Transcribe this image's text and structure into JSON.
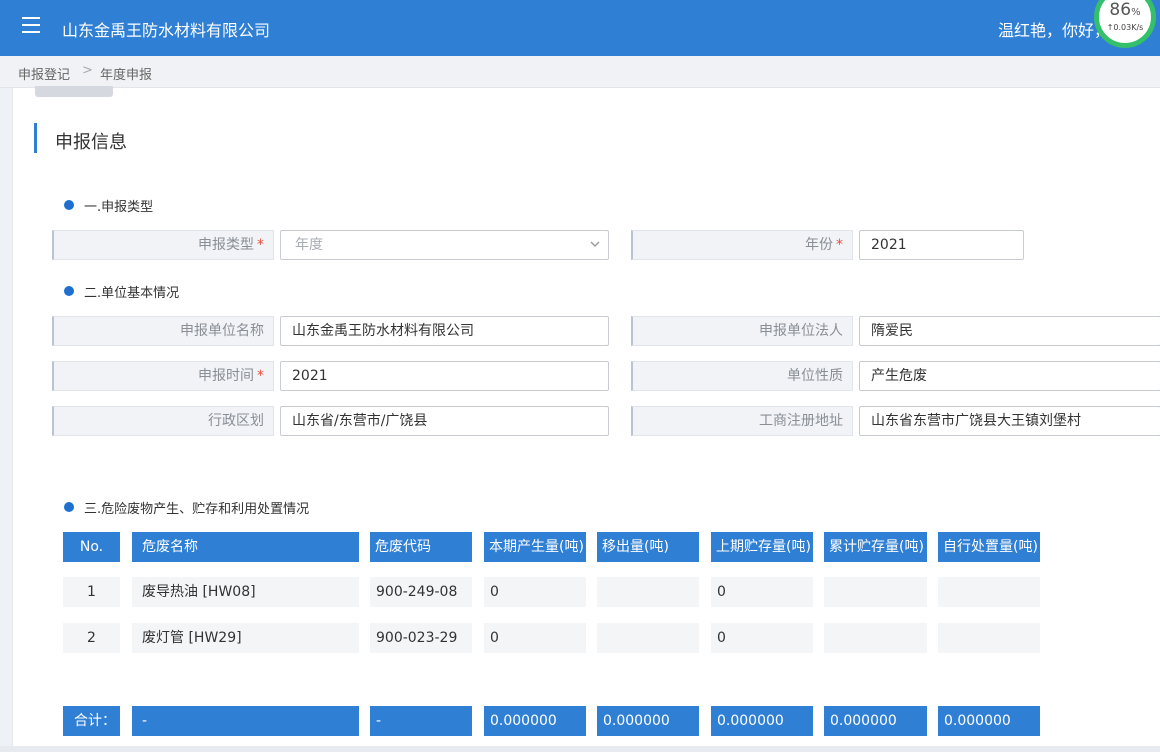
{
  "topbar": {
    "app_title": "山东金禹王防水材料有限公司",
    "user_greeting": "温红艳，你好，"
  },
  "net_widget": {
    "percent": "86",
    "percent_unit": "%",
    "speed": "↑0.03K/s"
  },
  "breadcrumb": {
    "items": [
      "申报登记",
      "年度申报"
    ],
    "separator": ">"
  },
  "section": {
    "title": "申报信息"
  },
  "part1": {
    "title": "一.申报类型",
    "declare_type_label": "申报类型",
    "declare_type_value": "年度",
    "year_label": "年份",
    "year_value": "2021",
    "required_mark": "*"
  },
  "part2": {
    "title": "二.单位基本情况",
    "unit_name_label": "申报单位名称",
    "unit_name_value": "山东金禹王防水材料有限公司",
    "legal_person_label": "申报单位法人",
    "legal_person_value": "隋爱民",
    "declare_time_label": "申报时间",
    "declare_time_value": "2021",
    "unit_nature_label": "单位性质",
    "unit_nature_value": "产生危废",
    "region_label": "行政区划",
    "region_value": "山东省/东营市/广饶县",
    "reg_address_label": "工商注册地址",
    "reg_address_value": "山东省东营市广饶县大王镇刘堡村"
  },
  "part3": {
    "title": "三.危险废物产生、贮存和利用处置情况",
    "headers": [
      "No.",
      "危废名称",
      "危废代码",
      "本期产生量(吨)",
      "移出量(吨)",
      "上期贮存量(吨)",
      "累计贮存量(吨)",
      "自行处置量(吨)"
    ],
    "rows": [
      [
        "1",
        "废导热油 [HW08]",
        "900-249-08",
        "0",
        "",
        "0",
        "",
        ""
      ],
      [
        "2",
        "废灯管 [HW29]",
        "900-023-29",
        "0",
        "",
        "0",
        "",
        ""
      ]
    ],
    "totals": [
      "合计：",
      "-",
      "-",
      "0.000000",
      "0.000000",
      "0.000000",
      "0.000000",
      "0.000000"
    ]
  }
}
